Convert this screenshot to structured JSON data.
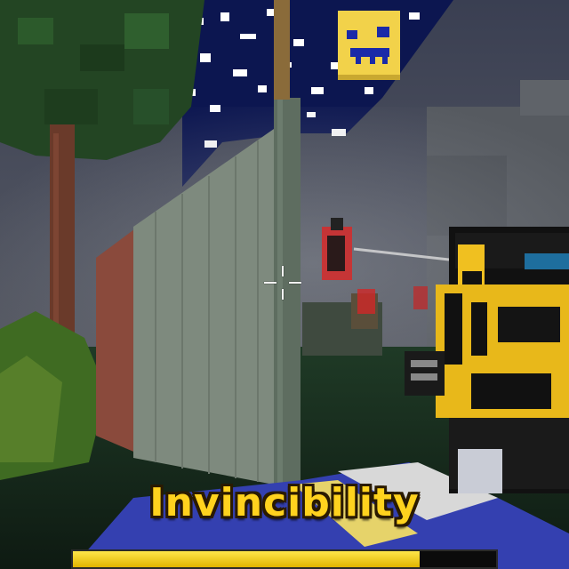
{
  "hud": {
    "ability_label": "Invincibility",
    "ability_progress": 0.82,
    "crosshair_visible": true
  },
  "colors": {
    "label_fill": "#ffd21e",
    "label_outline": "#2a1a00",
    "progress_fill": "#f2cc10",
    "sky": "#2b2f40",
    "foliage": "#244a26",
    "wall": "#50605a"
  },
  "scene": {
    "description_icons": [
      "moon-face-icon",
      "weapon-icon",
      "enemy-icon",
      "tree-icon"
    ]
  }
}
